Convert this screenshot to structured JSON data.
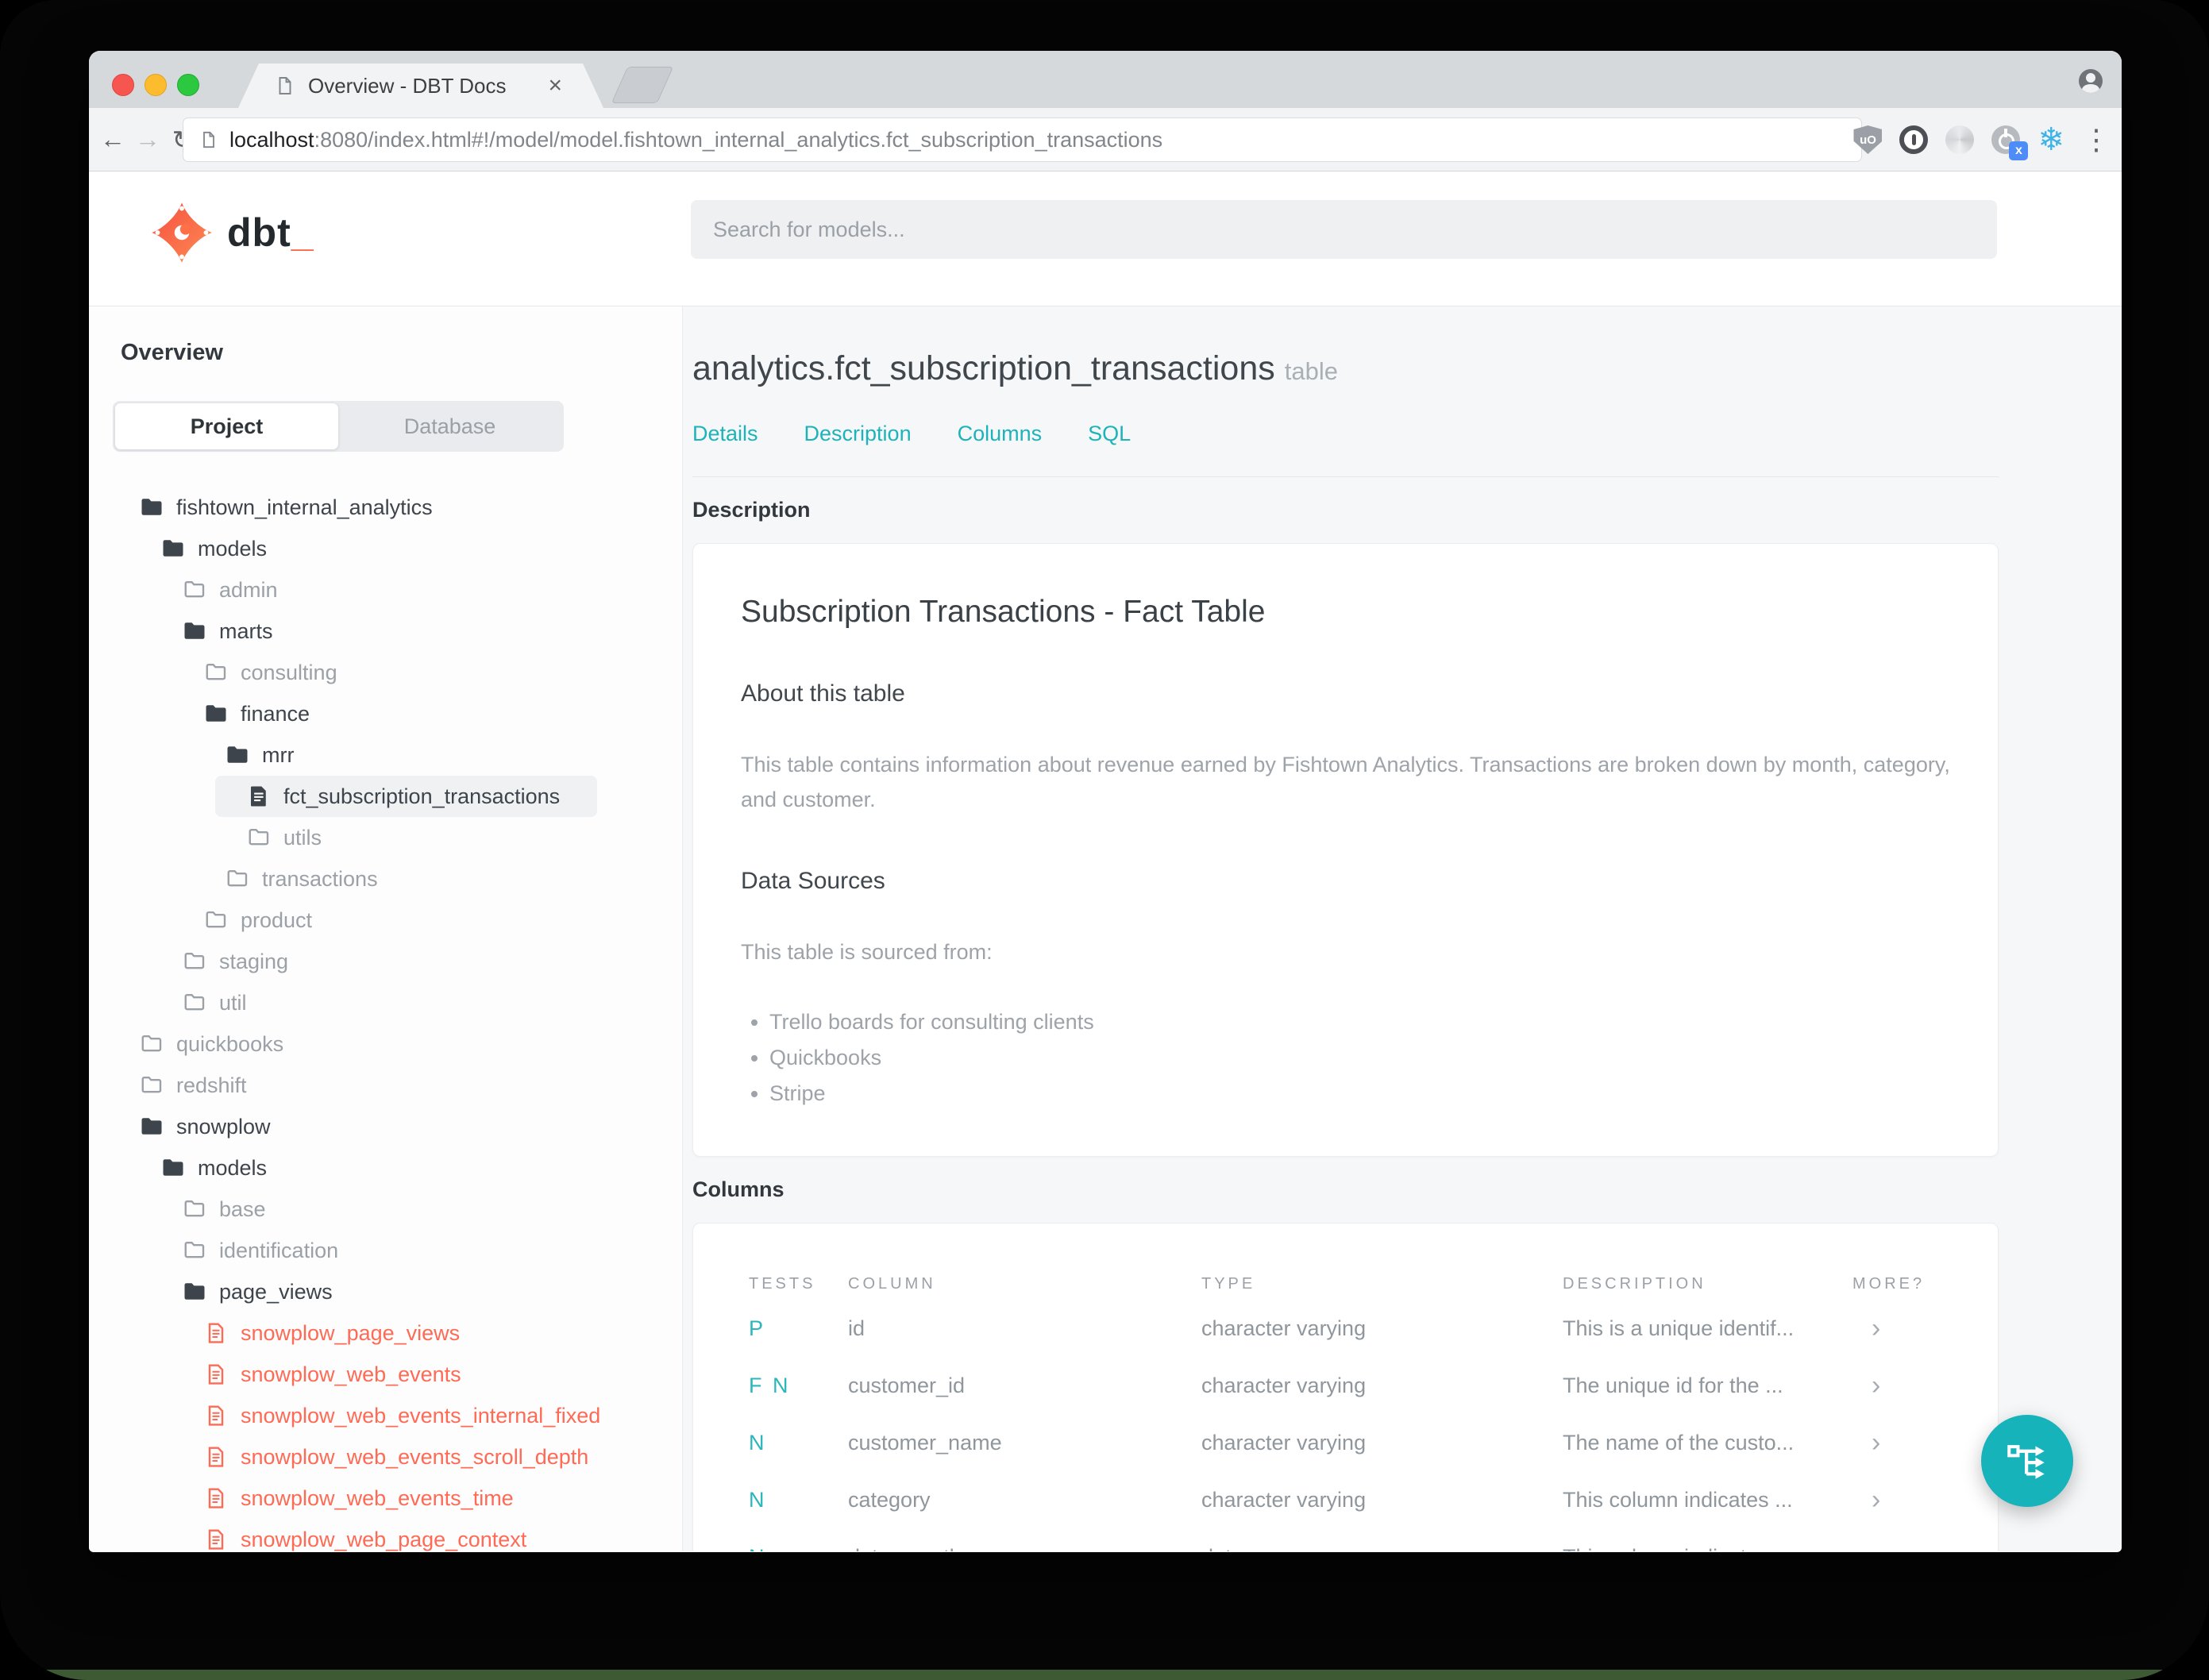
{
  "browser": {
    "tab_title": "Overview - DBT Docs",
    "tab_close": "×",
    "url_host": "localhost",
    "url_path": ":8080/index.html#!/model/model.fishtown_internal_analytics.fct_subscription_transactions",
    "back": "←",
    "forward": "→",
    "reload": "↻",
    "snowflake": "❄",
    "menu": "⋮",
    "ublock_label": "uO",
    "power_badge": "x"
  },
  "header": {
    "logo_word": "dbt",
    "logo_cursor": "_",
    "search_placeholder": "Search for models..."
  },
  "sidebar": {
    "title": "Overview",
    "tabs": [
      {
        "label": "Project",
        "active": true
      },
      {
        "label": "Database",
        "active": false
      }
    ],
    "tree": [
      {
        "label": "fishtown_internal_analytics",
        "type": "folder-open",
        "level": 0
      },
      {
        "label": "models",
        "type": "folder-open",
        "level": 1
      },
      {
        "label": "admin",
        "type": "folder-closed",
        "level": 2
      },
      {
        "label": "marts",
        "type": "folder-open",
        "level": 2
      },
      {
        "label": "consulting",
        "type": "folder-closed",
        "level": 3
      },
      {
        "label": "finance",
        "type": "folder-open",
        "level": 3
      },
      {
        "label": "mrr",
        "type": "folder-open",
        "level": 4
      },
      {
        "label": "fct_subscription_transactions",
        "type": "file-solid",
        "level": 5,
        "selected": true
      },
      {
        "label": "utils",
        "type": "folder-closed",
        "level": 5
      },
      {
        "label": "transactions",
        "type": "folder-closed",
        "level": 4
      },
      {
        "label": "product",
        "type": "folder-closed",
        "level": 3
      },
      {
        "label": "staging",
        "type": "folder-closed",
        "level": 2
      },
      {
        "label": "util",
        "type": "folder-closed",
        "level": 2
      },
      {
        "label": "quickbooks",
        "type": "folder-closed",
        "level": 0
      },
      {
        "label": "redshift",
        "type": "folder-closed",
        "level": 0
      },
      {
        "label": "snowplow",
        "type": "folder-open",
        "level": 0
      },
      {
        "label": "models",
        "type": "folder-open",
        "level": 1
      },
      {
        "label": "base",
        "type": "folder-closed",
        "level": 2
      },
      {
        "label": "identification",
        "type": "folder-closed",
        "level": 2
      },
      {
        "label": "page_views",
        "type": "folder-open",
        "level": 2
      },
      {
        "label": "snowplow_page_views",
        "type": "file-red",
        "level": 3
      },
      {
        "label": "snowplow_web_events",
        "type": "file-red",
        "level": 3
      },
      {
        "label": "snowplow_web_events_internal_fixed",
        "type": "file-red",
        "level": 3
      },
      {
        "label": "snowplow_web_events_scroll_depth",
        "type": "file-red",
        "level": 3
      },
      {
        "label": "snowplow_web_events_time",
        "type": "file-red",
        "level": 3
      },
      {
        "label": "snowplow_web_page_context",
        "type": "file-red",
        "level": 3
      }
    ]
  },
  "main": {
    "title": "analytics.fct_subscription_transactions",
    "title_badge": "table",
    "nav": [
      "Details",
      "Description",
      "Columns",
      "SQL"
    ],
    "description": {
      "section_heading": "Description",
      "card_title": "Subscription Transactions - Fact Table",
      "about_heading": "About this table",
      "about_text": "This table contains information about revenue earned by Fishtown Analytics. Transactions are broken down by month, category, and customer.",
      "sources_heading": "Data Sources",
      "sources_intro": "This table is sourced from:",
      "sources": [
        "Trello boards for consulting clients",
        "Quickbooks",
        "Stripe"
      ]
    },
    "columns": {
      "section_heading": "Columns",
      "headers": {
        "tests": "TESTS",
        "column": "COLUMN",
        "type": "TYPE",
        "description": "DESCRIPTION",
        "more": "MORE?"
      },
      "rows": [
        {
          "tests": "P",
          "column": "id",
          "type": "character varying",
          "description": "This is a unique identif...",
          "more": "›"
        },
        {
          "tests": "F N",
          "column": "customer_id",
          "type": "character varying",
          "description": "The unique id for the ...",
          "more": "›"
        },
        {
          "tests": "N",
          "column": "customer_name",
          "type": "character varying",
          "description": "The name of the custo...",
          "more": "›"
        },
        {
          "tests": "N",
          "column": "category",
          "type": "character varying",
          "description": "This column indicates ...",
          "more": "›"
        },
        {
          "tests": "N",
          "column": "date_month",
          "type": "date",
          "description": "This column indicates ...",
          "more": "›"
        }
      ]
    }
  },
  "colors": {
    "accent_teal": "#1cb3ba",
    "model_red": "#ff6a55",
    "brand_orange": "#ff694b",
    "fab_teal": "#17b3ba"
  }
}
